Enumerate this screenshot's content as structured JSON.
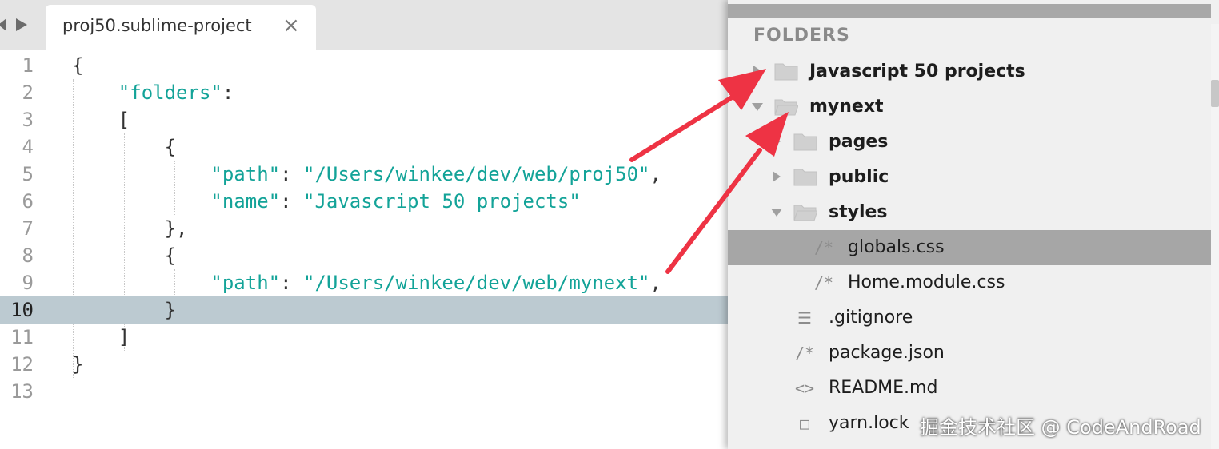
{
  "tab": {
    "title": "proj50.sublime-project",
    "close_glyph": "×"
  },
  "editor": {
    "active_line": 10,
    "lines": [
      {
        "n": "1",
        "segs": [
          [
            "p",
            "{"
          ]
        ]
      },
      {
        "n": "2",
        "segs": [
          [
            "p",
            "    "
          ],
          [
            "s",
            "\"folders\""
          ],
          [
            "p",
            ":"
          ]
        ]
      },
      {
        "n": "3",
        "segs": [
          [
            "p",
            "    ["
          ]
        ]
      },
      {
        "n": "4",
        "segs": [
          [
            "p",
            "        {"
          ]
        ]
      },
      {
        "n": "5",
        "segs": [
          [
            "p",
            "            "
          ],
          [
            "s",
            "\"path\""
          ],
          [
            "p",
            ": "
          ],
          [
            "s",
            "\"/Users/winkee/dev/web/proj50\""
          ],
          [
            "p",
            ","
          ]
        ]
      },
      {
        "n": "6",
        "segs": [
          [
            "p",
            "            "
          ],
          [
            "s",
            "\"name\""
          ],
          [
            "p",
            ": "
          ],
          [
            "s",
            "\"Javascript 50 projects\""
          ]
        ]
      },
      {
        "n": "7",
        "segs": [
          [
            "p",
            "        },"
          ]
        ]
      },
      {
        "n": "8",
        "segs": [
          [
            "p",
            "        {"
          ]
        ]
      },
      {
        "n": "9",
        "segs": [
          [
            "p",
            "            "
          ],
          [
            "s",
            "\"path\""
          ],
          [
            "p",
            ": "
          ],
          [
            "s",
            "\"/Users/winkee/dev/web/mynext\""
          ],
          [
            "p",
            ","
          ]
        ]
      },
      {
        "n": "10",
        "segs": [
          [
            "p",
            "        }"
          ]
        ]
      },
      {
        "n": "11",
        "segs": [
          [
            "p",
            "    ]"
          ]
        ]
      },
      {
        "n": "12",
        "segs": [
          [
            "p",
            "}"
          ]
        ]
      },
      {
        "n": "13",
        "segs": []
      }
    ]
  },
  "sidebar": {
    "header": "FOLDERS",
    "items": [
      {
        "label": "Javascript 50 projects",
        "bold": true,
        "icon": "folder-closed-icon",
        "disclosure": "right"
      },
      {
        "label": "mynext",
        "bold": true,
        "icon": "folder-open-icon",
        "disclosure": "down"
      },
      {
        "label": "pages",
        "bold": true,
        "icon": "folder-closed-icon",
        "disclosure": "right"
      },
      {
        "label": "public",
        "bold": true,
        "icon": "folder-closed-icon",
        "disclosure": "right"
      },
      {
        "label": "styles",
        "bold": true,
        "icon": "folder-open-icon",
        "disclosure": "down"
      },
      {
        "label": "globals.css",
        "bold": false,
        "icon": "comment-file-icon",
        "selected": true
      },
      {
        "label": "Home.module.css",
        "bold": false,
        "icon": "comment-file-icon"
      },
      {
        "label": ".gitignore",
        "bold": false,
        "icon": "text-lines-icon"
      },
      {
        "label": "package.json",
        "bold": false,
        "icon": "comment-file-icon"
      },
      {
        "label": "README.md",
        "bold": false,
        "icon": "code-brackets-icon"
      },
      {
        "label": "yarn.lock",
        "bold": false,
        "icon": "blank-file-icon"
      }
    ]
  },
  "watermark": "掘金技术社区 @ CodeAndRoad",
  "colors": {
    "string": "#13a398",
    "arrow": "#ee3344",
    "active_line": "#bccad1",
    "selected_row": "#a6a6a6"
  }
}
